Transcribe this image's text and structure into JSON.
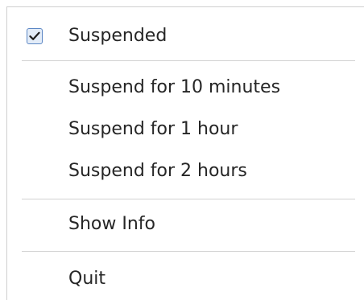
{
  "menu": {
    "suspended": {
      "label": "Suspended",
      "checked": true
    },
    "suspend_10_min": {
      "label": "Suspend for 10 minutes"
    },
    "suspend_1_hour": {
      "label": "Suspend for 1 hour"
    },
    "suspend_2_hours": {
      "label": "Suspend for 2 hours"
    },
    "show_info": {
      "label": "Show Info"
    },
    "quit": {
      "label": "Quit"
    }
  },
  "colors": {
    "checkbox_border": "#5b86c4",
    "checkbox_fill": "#e3ecf8",
    "checkmark": "#1f1f1f",
    "separator": "#d2d2d2",
    "text": "#262626"
  }
}
